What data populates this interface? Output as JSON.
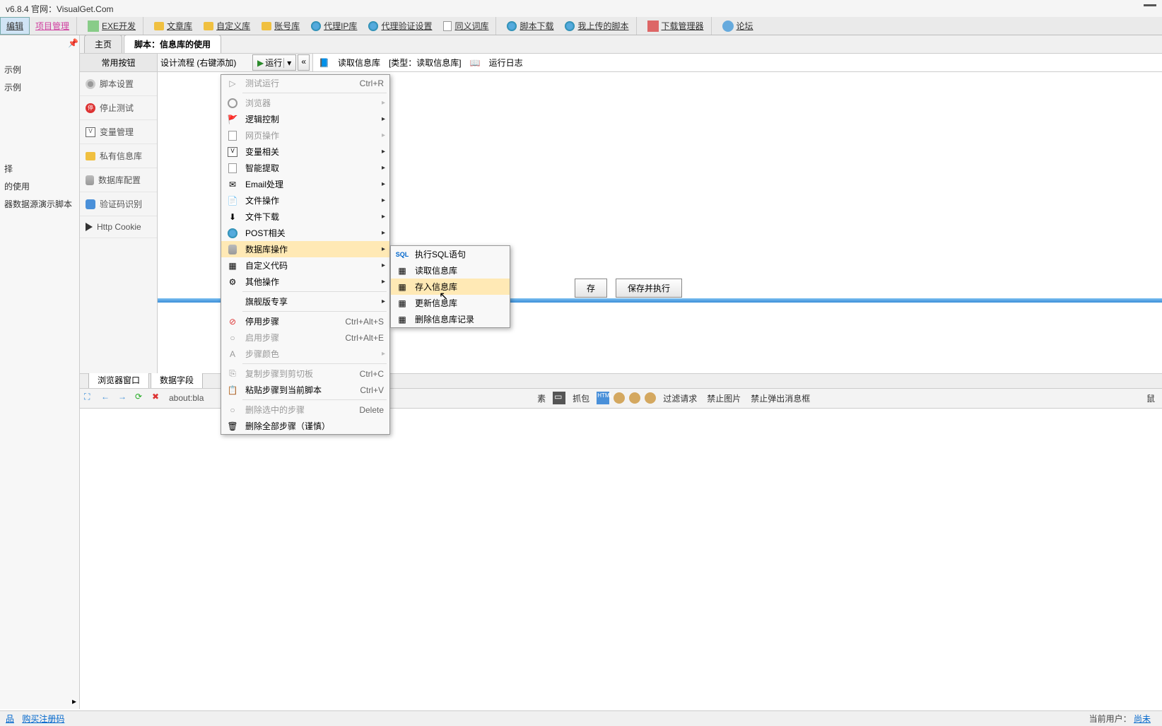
{
  "title": "v6.8.4  官网：VisualGet.Com",
  "toolbar": {
    "edit": "编辑",
    "project": "项目管理",
    "exe": "EXE开发",
    "article": "文章库",
    "custom": "自定义库",
    "account": "账号库",
    "proxy": "代理IP库",
    "proxy_verify": "代理验证设置",
    "synonym": "同义词库",
    "script_dl": "脚本下载",
    "my_upload": "我上传的脚本",
    "dl_mgr": "下载管理器",
    "forum": "论坛"
  },
  "left_tree": {
    "item1": "示例",
    "item2": "示例",
    "item3": "择",
    "item4": "的使用",
    "item5": "器数据源演示脚本"
  },
  "tabs": {
    "main": "主页",
    "script": "脚本：信息库的使用"
  },
  "sub": {
    "common_btn": "常用按钮",
    "design_flow": "设计流程 (右键添加)",
    "run": "运行",
    "read_info": "读取信息库",
    "type_label": "[类型：读取信息库]",
    "run_log": "运行日志"
  },
  "side": {
    "script_settings": "脚本设置",
    "stop_test": "停止测试",
    "var_mgmt": "变量管理",
    "private_info": "私有信息库",
    "db_config": "数据库配置",
    "captcha": "验证码识别",
    "http_cookie": "Http Cookie"
  },
  "save": {
    "save": "存",
    "save_run": "保存并执行"
  },
  "lower_tabs": {
    "browser": "浏览器窗口",
    "data_field": "数据字段"
  },
  "browser": {
    "addr": "about:bla",
    "capture": "抓包",
    "html": "HTML",
    "filter": "过滤请求",
    "block_img": "禁止图片",
    "block_popup": "禁止弹出消息框",
    "mouse": "鼠",
    "elem_btn": "素"
  },
  "ctx_menu": {
    "test_run": "测试运行",
    "test_run_sc": "Ctrl+R",
    "browser": "浏览器",
    "logic": "逻辑控制",
    "webpage": "网页操作",
    "variable": "变量相关",
    "smart_extract": "智能提取",
    "email": "Email处理",
    "file_op": "文件操作",
    "file_dl": "文件下载",
    "post": "POST相关",
    "db_op": "数据库操作",
    "custom_code": "自定义代码",
    "other": "其他操作",
    "flagship": "旗舰版专享",
    "disable_step": "停用步骤",
    "disable_sc": "Ctrl+Alt+S",
    "enable_step": "启用步骤",
    "enable_sc": "Ctrl+Alt+E",
    "step_color": "步骤颜色",
    "copy_steps": "复制步骤到剪切板",
    "copy_sc": "Ctrl+C",
    "paste_steps": "粘贴步骤到当前脚本",
    "paste_sc": "Ctrl+V",
    "delete_sel": "删除选中的步骤",
    "delete_sc": "Delete",
    "delete_all": "删除全部步骤（谨慎）"
  },
  "submenu": {
    "exec_sql": "执行SQL语句",
    "read_info": "读取信息库",
    "save_info": "存入信息库",
    "update_info": "更新信息库",
    "delete_rec": "删除信息库记录"
  },
  "status": {
    "link1": "品",
    "link2": "购买注册码",
    "user_label": "当前用户：",
    "user_status": "尚未"
  }
}
